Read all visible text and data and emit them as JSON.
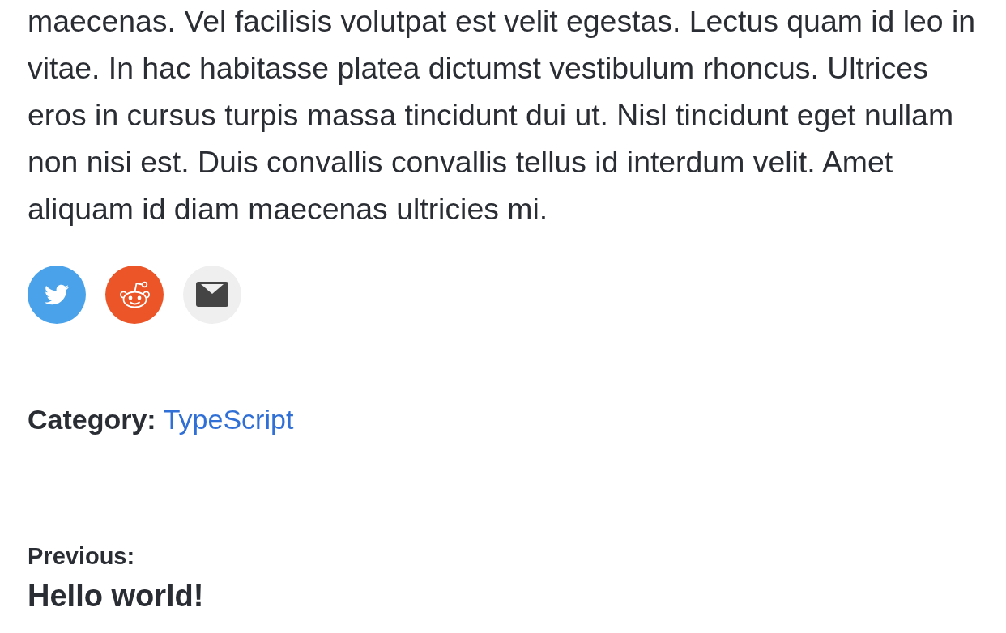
{
  "article": {
    "paragraph": "maecenas. Vel facilisis volutpat est velit egestas. Lectus quam id leo in vitae. In hac habitasse platea dictumst vestibulum rhoncus. Ultrices eros in cursus turpis massa tincidunt dui ut. Nisl tincidunt eget nullam non nisi est. Duis convallis convallis tellus id interdum velit. Amet aliquam id diam maecenas ultricies mi."
  },
  "share_buttons": [
    {
      "kind": "twitter"
    },
    {
      "kind": "reddit"
    },
    {
      "kind": "email"
    }
  ],
  "category": {
    "label": "Category:",
    "link": "TypeScript"
  },
  "post_navigation": {
    "label": "Previous:",
    "title": "Hello world!"
  }
}
